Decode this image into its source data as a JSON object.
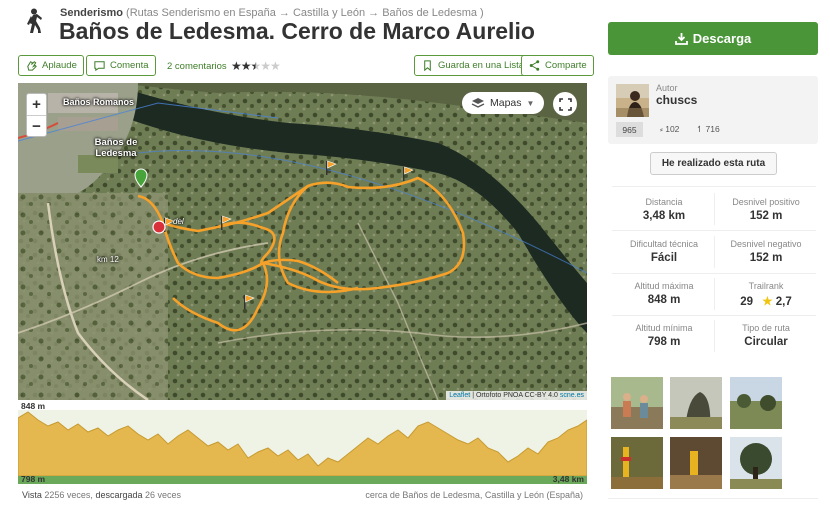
{
  "header": {
    "category": "Senderismo",
    "breadcrumb": "(Rutas Senderismo en España → Castilla y León → Baños de Ledesma )",
    "title": "Baños de Ledesma. Cerro de Marco Aurelio"
  },
  "actions": {
    "applaud": "Aplaude",
    "comment": "Comenta",
    "comments_count": "2 comentarios",
    "rating": 2.5,
    "save_list": "Guarda en una Lista",
    "share": "Comparte"
  },
  "map": {
    "layer_button": "Mapas",
    "labels": {
      "banos_romanos": "Baños Romanos",
      "town": "Baños de Ledesma",
      "km": "km 12",
      "del": "del"
    },
    "attribution_leaflet": "Leaflet",
    "attribution_rest": " | Ortofoto PNOA CC-BY 4.0 ",
    "attribution_scne": "scne.es"
  },
  "profile": {
    "max_label": "848 m",
    "min_label": "798 m",
    "distance_label": "3,48 km"
  },
  "footer": {
    "views_label": "Vista",
    "views": "2256 veces,",
    "downloads_label": "descargada",
    "downloads": "26 veces",
    "location": "cerca de Baños de Ledesma, Castilla y León (España)"
  },
  "sidebar": {
    "download_label": "Descarga",
    "author_label": "Autor",
    "author_name": "chuscs",
    "author_badge": "965",
    "author_followers": "102",
    "author_trails": "716",
    "done_button": "He realizado esta ruta",
    "stats": [
      {
        "label": "Distancia",
        "value": "3,48 km"
      },
      {
        "label": "Desnivel positivo",
        "value": "152 m"
      },
      {
        "label": "Dificultad técnica",
        "value": "Fácil"
      },
      {
        "label": "Desnivel negativo",
        "value": "152 m"
      },
      {
        "label": "Altitud máxima",
        "value": "848 m"
      },
      {
        "label": "Trailrank",
        "value": "29",
        "score": "2,7"
      },
      {
        "label": "Altitud mínima",
        "value": "798 m"
      },
      {
        "label": "Tipo de ruta",
        "value": "Circular"
      }
    ]
  },
  "colors": {
    "brand_green": "#4a9538",
    "track_orange": "#f5a12a",
    "profile_fill": "#e5b74f"
  }
}
